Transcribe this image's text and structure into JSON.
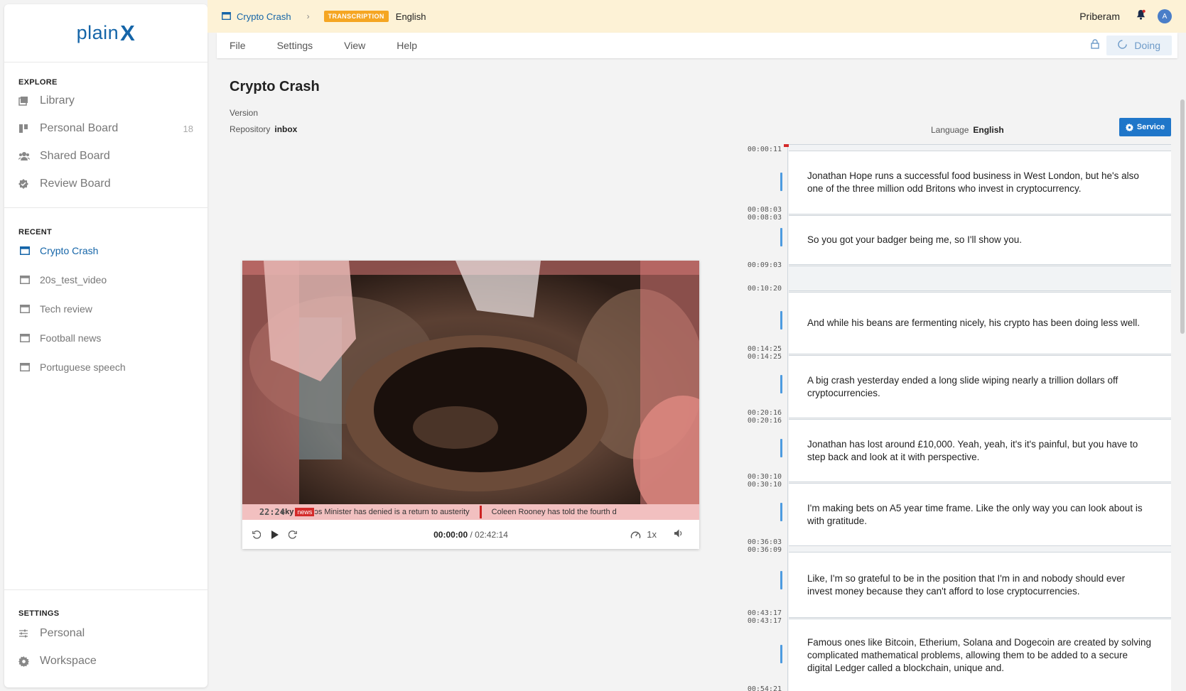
{
  "sidebar": {
    "logo": {
      "text": "plain",
      "mark": "X"
    },
    "explore": {
      "title": "EXPLORE",
      "items": [
        {
          "label": "Library",
          "icon": "library-icon"
        },
        {
          "label": "Personal Board",
          "icon": "board-icon",
          "count": "18"
        },
        {
          "label": "Shared Board",
          "icon": "users-icon"
        },
        {
          "label": "Review Board",
          "icon": "badge-check-icon"
        }
      ]
    },
    "recent": {
      "title": "RECENT",
      "items": [
        {
          "label": "Crypto Crash",
          "active": true
        },
        {
          "label": "20s_test_video"
        },
        {
          "label": "Tech review"
        },
        {
          "label": "Football news"
        },
        {
          "label": "Portuguese speech"
        }
      ]
    },
    "settings": {
      "title": "SETTINGS",
      "items": [
        {
          "label": "Personal",
          "icon": "sliders-icon"
        },
        {
          "label": "Workspace",
          "icon": "gear-icon"
        }
      ]
    }
  },
  "topbar": {
    "project": "Crypto Crash",
    "badge": "TRANSCRIPTION",
    "language": "English",
    "user": "Priberam",
    "avatar_initial": "A"
  },
  "menubar": {
    "items": [
      "File",
      "Settings",
      "View",
      "Help"
    ],
    "status": "Doing"
  },
  "main": {
    "title": "Crypto Crash",
    "version_label": "Version",
    "repository_label": "Repository",
    "repository_value": "inbox"
  },
  "video": {
    "ticker": {
      "brand": "sky",
      "news": "news",
      "time": "22:24",
      "headline1": "ɔs Minister has denied is a return to austerity",
      "headline2": "Coleen Rooney has told the fourth d"
    },
    "current_time": "00:00:00",
    "duration": "/ 02:42:14",
    "speed": "1x"
  },
  "panel": {
    "language_label": "Language",
    "language_value": "English",
    "service_label": "Service"
  },
  "segments": [
    {
      "start": "00:00:11",
      "end": "00:08:03",
      "text": "Jonathan Hope runs a successful food business in West London, but he's also one of the three million odd Britons who invest in cryptocurrency."
    },
    {
      "start": "00:08:03",
      "end": "00:09:03",
      "text": "So you got your badger being me, so I'll show you."
    },
    {
      "start": "00:09:03",
      "end": "00:10:20",
      "text": ""
    },
    {
      "start": "00:10:20",
      "end": "00:14:25",
      "text": "And while his beans are fermenting nicely, his crypto has been doing less well."
    },
    {
      "start": "00:14:25",
      "end": "00:20:16",
      "text": "A big crash yesterday ended a long slide wiping nearly a trillion dollars off cryptocurrencies."
    },
    {
      "start": "00:20:16",
      "end": "00:30:10",
      "text": "Jonathan has lost around £10,000. Yeah, yeah, it's it's painful, but you have to step back and look at it with perspective."
    },
    {
      "start": "00:30:10",
      "end": "00:36:03",
      "text": "I'm making bets on A5 year time frame. Like the only way you can look about is with gratitude."
    },
    {
      "start": "00:36:09",
      "end": "00:43:17",
      "text": "Like, I'm so grateful to be in the position that I'm in and nobody should ever invest money because they can't afford to lose cryptocurrencies."
    },
    {
      "start": "00:43:17",
      "end": "00:54:21",
      "text": "Famous ones like Bitcoin, Etherium, Solana and Dogecoin are created by solving complicated mathematical problems, allowing them to be added to a secure digital Ledger called a blockchain, unique and."
    }
  ]
}
